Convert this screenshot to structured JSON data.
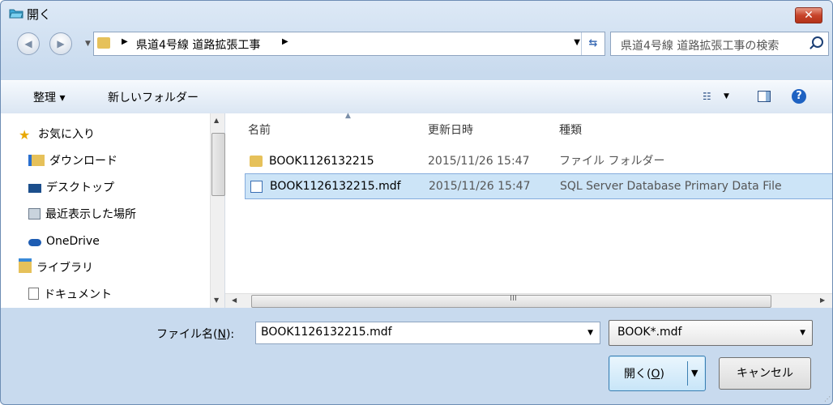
{
  "window": {
    "title": "開く",
    "close_label": "✕"
  },
  "nav": {
    "back_icon": "back-arrow-icon",
    "forward_icon": "forward-arrow-icon"
  },
  "address": {
    "path": "県道4号線 道路拡張工事",
    "refresh_icon": "refresh-icon"
  },
  "search": {
    "placeholder": "県道4号線 道路拡張工事の検索"
  },
  "toolbar": {
    "organize_label": "整理 ▾",
    "new_folder_label": "新しいフォルダー"
  },
  "sidebar": {
    "items": [
      {
        "label": "お気に入り",
        "icon": "star-icon"
      },
      {
        "label": "ダウンロード",
        "icon": "download-folder-icon"
      },
      {
        "label": "デスクトップ",
        "icon": "desktop-icon"
      },
      {
        "label": "最近表示した場所",
        "icon": "recent-places-icon"
      },
      {
        "label": "OneDrive",
        "icon": "onedrive-cloud-icon"
      },
      {
        "label": "ライブラリ",
        "icon": "library-icon"
      },
      {
        "label": "ドキュメント",
        "icon": "document-icon"
      }
    ]
  },
  "file_list": {
    "columns": [
      "名前",
      "更新日時",
      "種類"
    ],
    "rows": [
      {
        "name": "BOOK1126132215",
        "date": "2015/11/26 15:47",
        "type": "ファイル フォルダー",
        "icon": "folder-icon",
        "selected": false
      },
      {
        "name": "BOOK1126132215.mdf",
        "date": "2015/11/26 15:47",
        "type": "SQL Server Database Primary Data File",
        "icon": "database-file-icon",
        "selected": true
      }
    ],
    "hscroll_grip": "III"
  },
  "bottom": {
    "filename_label_prefix": "ファイル名(",
    "filename_label_key": "N",
    "filename_label_suffix": "):",
    "filename_value": "BOOK1126132215.mdf",
    "filter_value": "BOOK*.mdf",
    "open_label_prefix": "開く(",
    "open_label_key": "O",
    "open_label_suffix": ")",
    "cancel_label": "キャンセル"
  }
}
